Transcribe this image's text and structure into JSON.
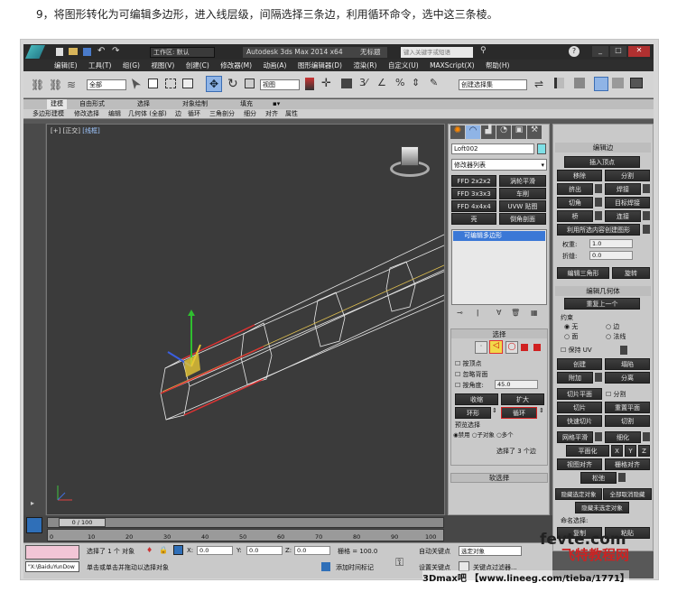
{
  "page_title": "9，将图形转化为可编辑多边形，进入线层级，间隔选择三条边，利用循环命令，选中这三条棱。",
  "titlebar": {
    "workspace": "工作区: 默认",
    "app_title": "Autodesk 3ds Max  2014 x64",
    "unnamed": "无标题",
    "search_placeholder": "键入关键字或短语"
  },
  "menu": [
    "编辑(E)",
    "工具(T)",
    "组(G)",
    "视图(V)",
    "创建(C)",
    "修改器(M)",
    "动画(A)",
    "图形编辑器(D)",
    "渲染(R)",
    "自定义(U)",
    "MAXScript(X)",
    "帮助(H)"
  ],
  "toolbar": {
    "filter": "全部",
    "ref_coord": "视图",
    "selset": "创建选择集"
  },
  "ribbon_tabs": [
    "建模",
    "自由形式",
    "选择",
    "对象绘制",
    "填充"
  ],
  "ribbon_sub": [
    "多边形建模",
    "修改选择",
    "编辑",
    "几何体 (全部)",
    "边",
    "循环",
    "三角剖分",
    "细分",
    "对齐",
    "属性"
  ],
  "viewport": {
    "label_plus": "[+]",
    "label_view": "[正交]",
    "label_shading": "[线框]"
  },
  "cmd": {
    "object_name": "Loft002",
    "modifier_list": "修改器列表",
    "mod_buttons": [
      [
        "FFD 2x2x2",
        "涡轮平滑"
      ],
      [
        "FFD 3x3x3",
        "车削"
      ],
      [
        "FFD 4x4x4",
        "UVW 贴图"
      ],
      [
        "壳",
        "倒角剖面"
      ]
    ],
    "stack_item": "可编辑多边形",
    "selection": {
      "title": "选择",
      "by_vertex": "按顶点",
      "ignore_back": "忽略背面",
      "by_angle": "按角度:",
      "angle": "45.0",
      "shrink": "收缩",
      "grow": "扩大",
      "ring": "环形",
      "loop": "循环",
      "preview": "预览选择",
      "disable": "禁用",
      "subobj": "子对象",
      "multi": "多个",
      "status": "选择了 3 个边"
    },
    "soft_selection": "软选择"
  },
  "edit_edges": {
    "title": "编辑边",
    "insert_vertex": "插入顶点",
    "remove": "移除",
    "split": "分割",
    "extrude": "挤出",
    "weld": "焊接",
    "chamfer": "切角",
    "target_weld": "目标焊接",
    "bridge": "桥",
    "connect": "连接",
    "create_shape": "利用所选内容创建图形",
    "weight": "权重:",
    "weight_val": "1.0",
    "crease": "折缝:",
    "crease_val": "0.0",
    "edit_tri": "编辑三角形",
    "turn": "旋转"
  },
  "edit_geom": {
    "title": "编辑几何体",
    "repeat": "重复上一个",
    "constraints": "约束",
    "none": "无",
    "edge": "边",
    "face": "面",
    "normal": "法线",
    "preserve_uv": "保持 UV",
    "create": "创建",
    "collapse": "塌陷",
    "attach": "附加",
    "detach": "分离",
    "slice_plane": "切片平面",
    "split": "分割",
    "slice": "切片",
    "reset_plane": "重置平面",
    "quickslice": "快速切片",
    "cut": "切割",
    "msmooth": "网格平滑",
    "tessellate": "细化",
    "make_planar": "平面化",
    "x": "X",
    "y": "Y",
    "z": "Z",
    "view_align": "视图对齐",
    "grid_align": "栅格对齐",
    "relax": "松弛",
    "hide_sel": "隐藏选定对象",
    "unhide_all": "全部取消隐藏",
    "hide_unsel": "隐藏未选定对象",
    "named_sel": "命名选择:",
    "copy": "复制",
    "paste": "粘贴"
  },
  "timeline": {
    "range": "0 / 100",
    "ticks": [
      "0",
      "10",
      "20",
      "30",
      "40",
      "50",
      "60",
      "70",
      "80",
      "90",
      "100"
    ]
  },
  "status": {
    "script_field": "\"X:\\BaiduYunDow",
    "msg1": "选择了 1 个 对象",
    "msg2": "单击或单击并拖动以选择对象",
    "x_label": "X:",
    "x": "0.0",
    "y_label": "Y:",
    "y": "0.0",
    "z_label": "Z:",
    "z": "0.0",
    "grid": "栅格 = 100.0",
    "add_time": "添加时间标记",
    "auto_key": "自动关键点",
    "set_key": "设置关键点",
    "sel_obj": "选定对象",
    "key_filter": "关键点过滤器..."
  },
  "watermark": {
    "logo": "fevte.com",
    "logo_cn": "飞特教程网",
    "bottom": "3Dmax吧 【www.lineeg.com/tieba/1771】"
  },
  "colors": {
    "panel": "#c9c9c9",
    "viewport": "#3b3b3b",
    "accent_blue": "#2f6fb8"
  }
}
